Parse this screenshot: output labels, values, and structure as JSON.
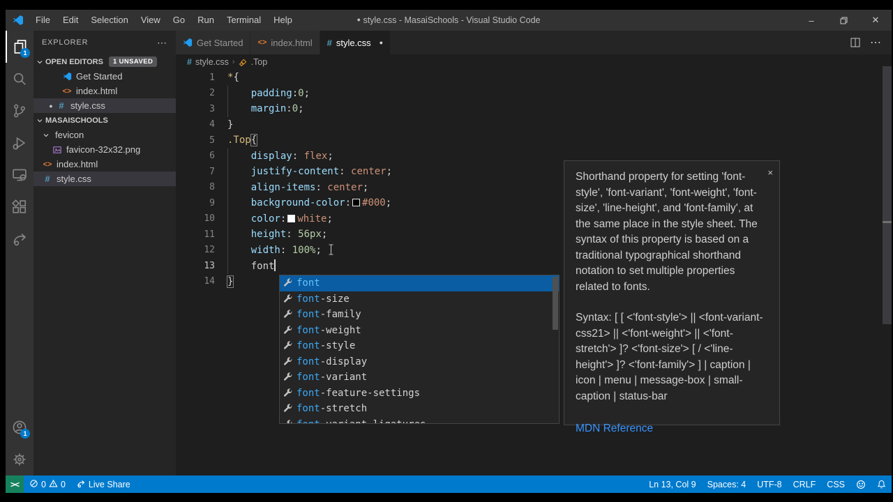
{
  "colors": {
    "status_bar": "#007acc",
    "remote_indicator": "#16825d",
    "suggest_selected": "#0a5da2",
    "selector_token": "#d7ba7d",
    "property_token": "#9cdcfe",
    "value_token": "#ce9178",
    "number_token": "#b5cea8",
    "match_highlight": "#3ba9f5"
  },
  "title_bar": {
    "dirty_indicator": "●",
    "title": "style.css - MasaiSchools - Visual Studio Code",
    "menus": [
      "File",
      "Edit",
      "Selection",
      "View",
      "Go",
      "Run",
      "Terminal",
      "Help"
    ]
  },
  "activity_bar": {
    "top": [
      {
        "icon": "files-icon",
        "active": true,
        "badge": "1"
      },
      {
        "icon": "search-icon"
      },
      {
        "icon": "source-control-icon"
      },
      {
        "icon": "run-debug-icon"
      },
      {
        "icon": "remote-explorer-icon"
      },
      {
        "icon": "extensions-icon"
      },
      {
        "icon": "live-share-icon"
      }
    ],
    "bottom": [
      {
        "icon": "account-icon",
        "badge": "1"
      },
      {
        "icon": "settings-gear-icon"
      }
    ]
  },
  "sidebar": {
    "header": "EXPLORER",
    "header_more": "⋯",
    "open_editors": {
      "label": "OPEN EDITORS",
      "badge": "1 UNSAVED",
      "items": [
        {
          "label": "Get Started",
          "icon": "vscode"
        },
        {
          "label": "index.html",
          "icon": "html"
        },
        {
          "label": "style.css",
          "icon": "css",
          "dirty": "●",
          "selected": true
        }
      ]
    },
    "folder": {
      "label": "MASAISCHOOLS",
      "items": [
        {
          "label": "fevicon",
          "icon": "chevron",
          "indent": 1
        },
        {
          "label": "favicon-32x32.png",
          "icon": "image",
          "indent": 2
        },
        {
          "label": "index.html",
          "icon": "html",
          "indent": 1
        },
        {
          "label": "style.css",
          "icon": "css",
          "indent": 1,
          "selected": true
        }
      ]
    }
  },
  "tabs": [
    {
      "label": "Get Started",
      "icon": "vscode",
      "active": false
    },
    {
      "label": "index.html",
      "icon": "html",
      "active": false
    },
    {
      "label": "style.css",
      "icon": "css",
      "active": true,
      "dirty": "●"
    }
  ],
  "breadcrumb": {
    "file": "style.css",
    "separator": "›",
    "symbol": ".Top"
  },
  "editor": {
    "cursor_line": 13,
    "lines": [
      {
        "n": 1,
        "indent": 0,
        "tokens": [
          {
            "t": "*",
            "y": "sel"
          },
          {
            "t": "{",
            "y": "punc"
          }
        ]
      },
      {
        "n": 2,
        "indent": 1,
        "tokens": [
          {
            "t": "padding",
            "y": "prop"
          },
          {
            "t": ":",
            "y": "punc"
          },
          {
            "t": "0",
            "y": "num"
          },
          {
            "t": ";",
            "y": "punc"
          }
        ]
      },
      {
        "n": 3,
        "indent": 1,
        "tokens": [
          {
            "t": "margin",
            "y": "prop"
          },
          {
            "t": ":",
            "y": "punc"
          },
          {
            "t": "0",
            "y": "num"
          },
          {
            "t": ";",
            "y": "punc"
          }
        ]
      },
      {
        "n": 4,
        "indent": 0,
        "tokens": [
          {
            "t": "}",
            "y": "punc"
          }
        ]
      },
      {
        "n": 5,
        "indent": 0,
        "tokens": [
          {
            "t": ".Top",
            "y": "sel"
          },
          {
            "t": "{",
            "y": "bracket"
          }
        ]
      },
      {
        "n": 6,
        "indent": 1,
        "tokens": [
          {
            "t": "display",
            "y": "prop"
          },
          {
            "t": ": ",
            "y": "punc"
          },
          {
            "t": "flex",
            "y": "val"
          },
          {
            "t": ";",
            "y": "punc"
          }
        ]
      },
      {
        "n": 7,
        "indent": 1,
        "tokens": [
          {
            "t": "justify-content",
            "y": "prop"
          },
          {
            "t": ": ",
            "y": "punc"
          },
          {
            "t": "center",
            "y": "val"
          },
          {
            "t": ";",
            "y": "punc"
          }
        ]
      },
      {
        "n": 8,
        "indent": 1,
        "tokens": [
          {
            "t": "align-items",
            "y": "prop"
          },
          {
            "t": ": ",
            "y": "punc"
          },
          {
            "t": "center",
            "y": "val"
          },
          {
            "t": ";",
            "y": "punc"
          }
        ]
      },
      {
        "n": 9,
        "indent": 1,
        "tokens": [
          {
            "t": "background-color",
            "y": "prop"
          },
          {
            "t": ":",
            "y": "punc"
          },
          {
            "y": "swatch_black"
          },
          {
            "t": "#000",
            "y": "val"
          },
          {
            "t": ";",
            "y": "punc"
          }
        ]
      },
      {
        "n": 10,
        "indent": 1,
        "tokens": [
          {
            "t": "color",
            "y": "prop"
          },
          {
            "t": ":",
            "y": "punc"
          },
          {
            "y": "swatch_white"
          },
          {
            "t": "white",
            "y": "val"
          },
          {
            "t": ";",
            "y": "punc"
          }
        ]
      },
      {
        "n": 11,
        "indent": 1,
        "tokens": [
          {
            "t": "height",
            "y": "prop"
          },
          {
            "t": ": ",
            "y": "punc"
          },
          {
            "t": "56px",
            "y": "num"
          },
          {
            "t": ";",
            "y": "punc"
          }
        ]
      },
      {
        "n": 12,
        "indent": 1,
        "tokens": [
          {
            "t": "width",
            "y": "prop"
          },
          {
            "t": ": ",
            "y": "punc"
          },
          {
            "t": "100%",
            "y": "num"
          },
          {
            "t": ";",
            "y": "punc"
          },
          {
            "y": "ibeam"
          }
        ]
      },
      {
        "n": 13,
        "indent": 1,
        "tokens": [
          {
            "t": "font",
            "y": "plain"
          },
          {
            "y": "caret"
          }
        ]
      },
      {
        "n": 14,
        "indent": 0,
        "tokens": [
          {
            "t": "}",
            "y": "bracket"
          }
        ]
      }
    ]
  },
  "suggest": {
    "selected_index": 0,
    "items": [
      {
        "match": "font",
        "rest": ""
      },
      {
        "match": "font",
        "rest": "-size"
      },
      {
        "match": "font",
        "rest": "-family"
      },
      {
        "match": "font",
        "rest": "-weight"
      },
      {
        "match": "font",
        "rest": "-style"
      },
      {
        "match": "font",
        "rest": "-display"
      },
      {
        "match": "font",
        "rest": "-variant"
      },
      {
        "match": "font",
        "rest": "-feature-settings"
      },
      {
        "match": "font",
        "rest": "-stretch"
      },
      {
        "match": "font",
        "rest": "-variant-ligatures"
      }
    ]
  },
  "doc_panel": {
    "close": "×",
    "description": "Shorthand property for setting 'font-style', 'font-variant', 'font-weight', 'font-size', 'line-height', and 'font-family', at the same place in the style sheet. The syntax of this property is based on a traditional typographical shorthand notation to set multiple properties related to fonts.",
    "syntax": "Syntax: [ [ <'font-style'> || <font-variant-css21> || <'font-weight'> || <'font-stretch'> ]? <'font-size'> [ / <'line-height'> ]? <'font-family'> ] | caption | icon | menu | message-box | small-caption | status-bar",
    "link": "MDN Reference"
  },
  "status_bar": {
    "remote": "><",
    "errors": "0",
    "warnings": "0",
    "live_share": "Live Share",
    "cursor_position": "Ln 13, Col 9",
    "indentation": "Spaces: 4",
    "encoding": "UTF-8",
    "eol": "CRLF",
    "language": "CSS"
  },
  "window_controls": {
    "minimize": "–",
    "maximize": "",
    "close": "✕"
  }
}
